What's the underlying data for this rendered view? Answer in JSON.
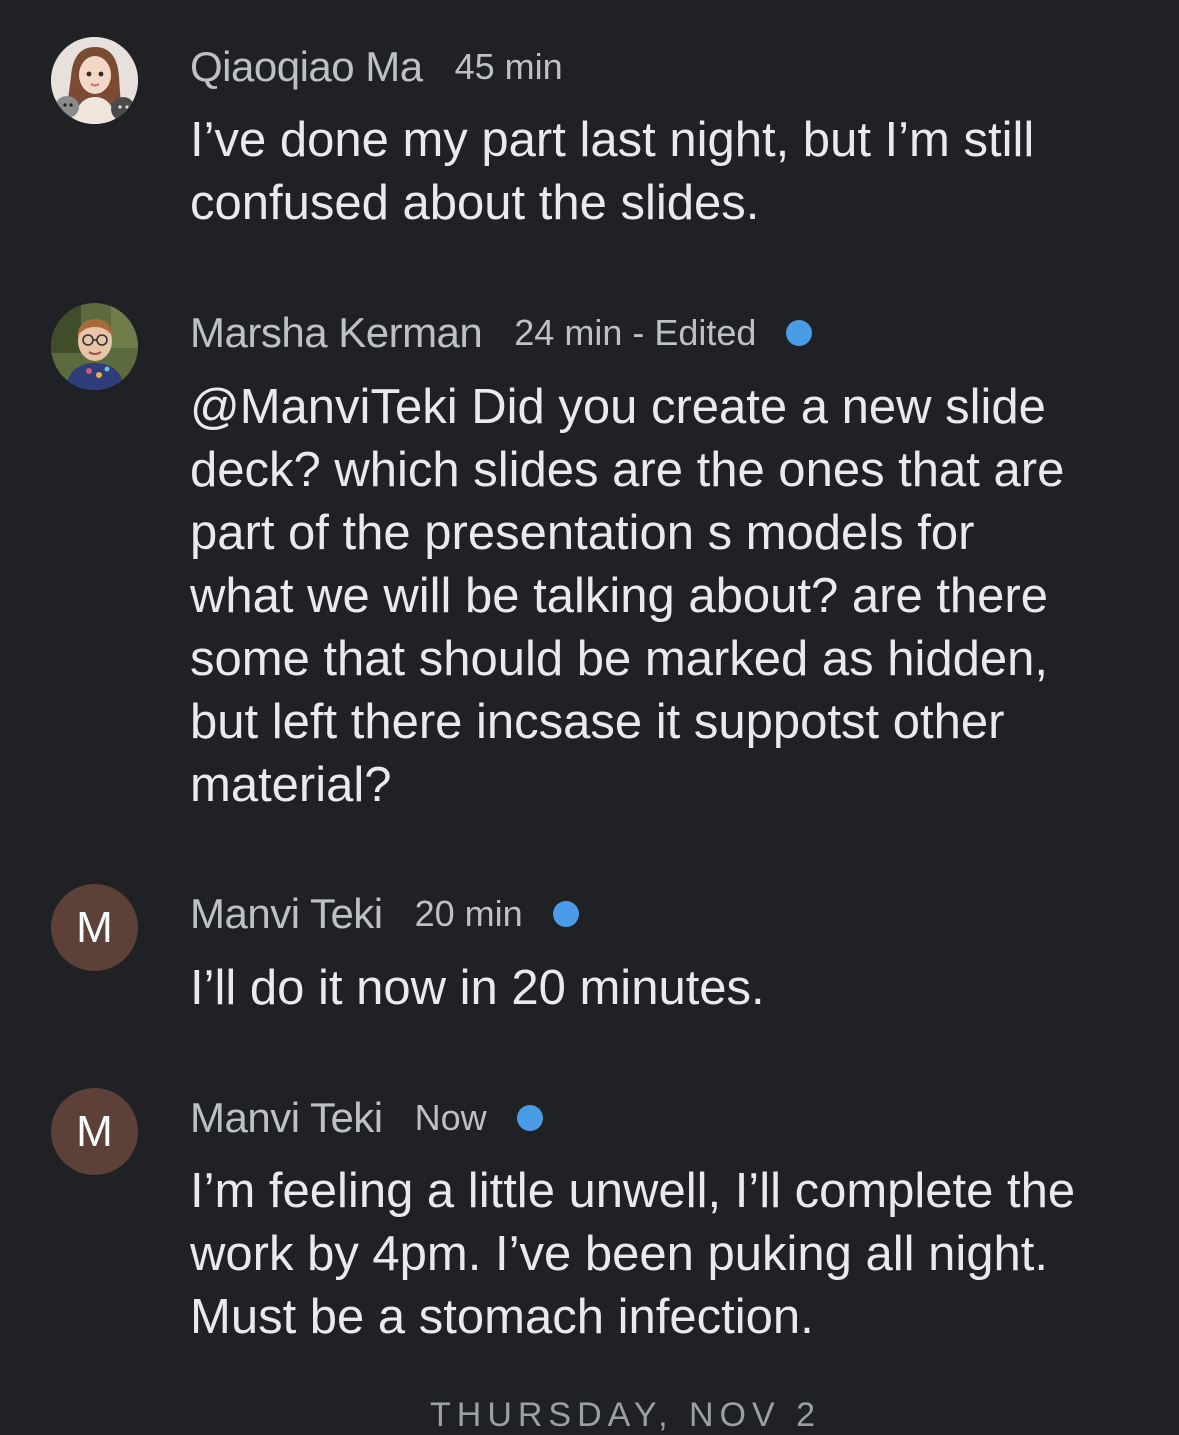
{
  "messages": [
    {
      "author": "Qiaoqiao Ma",
      "time": "45 min",
      "avatar_type": "photo-illustration",
      "unread_dot": false,
      "body_lines": [
        "I’ve done my part last night, but I’m still",
        "confused about the slides."
      ]
    },
    {
      "author": "Marsha Kerman",
      "time": "24 min - Edited",
      "avatar_type": "photo",
      "unread_dot": true,
      "body_lines": [
        "@ManviTeki Did you create a new slide",
        "deck? which slides are the ones that are",
        "part of the presentation s models for",
        "what we will be talking about? are there",
        "some that should be marked as hidden,",
        "but left there incsase it suppotst other",
        "material?"
      ]
    },
    {
      "author": "Manvi Teki",
      "time": "20 min",
      "avatar_letter": "M",
      "unread_dot": true,
      "body_lines": [
        "I’ll do it now in 20 minutes."
      ]
    },
    {
      "author": "Manvi Teki",
      "time": "Now",
      "avatar_letter": "M",
      "unread_dot": true,
      "body_lines": [
        "I’m feeling a little unwell, I’ll complete the",
        "work by 4pm. I’ve been puking all night.",
        "Must be a stomach infection."
      ]
    }
  ],
  "divider": {
    "label": "THURSDAY, NOV 2"
  },
  "colors": {
    "background": "#202124",
    "text_primary": "#e8eaed",
    "text_secondary": "#bdc1c6",
    "unread_dot": "#4a9ce6",
    "letter_avatar_bg": "#5d4037"
  }
}
